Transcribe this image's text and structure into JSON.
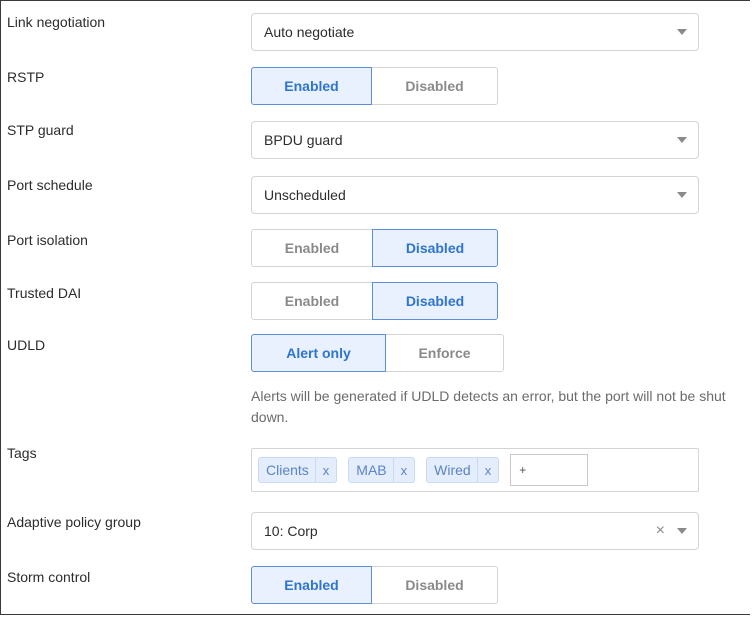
{
  "fields": {
    "link_negotiation": {
      "label": "Link negotiation",
      "value": "Auto negotiate"
    },
    "rstp": {
      "label": "RSTP",
      "options": [
        "Enabled",
        "Disabled"
      ],
      "selected": "Enabled"
    },
    "stp_guard": {
      "label": "STP guard",
      "value": "BPDU guard"
    },
    "port_schedule": {
      "label": "Port schedule",
      "value": "Unscheduled"
    },
    "port_isolation": {
      "label": "Port isolation",
      "options": [
        "Enabled",
        "Disabled"
      ],
      "selected": "Disabled"
    },
    "trusted_dai": {
      "label": "Trusted DAI",
      "options": [
        "Enabled",
        "Disabled"
      ],
      "selected": "Disabled"
    },
    "udld": {
      "label": "UDLD",
      "options": [
        "Alert only",
        "Enforce"
      ],
      "selected": "Alert only",
      "help": "Alerts will be generated if UDLD detects an error, but the port will not be shut down."
    },
    "tags": {
      "label": "Tags",
      "items": [
        "Clients",
        "MAB",
        "Wired"
      ],
      "remove_glyph": "x",
      "input_placeholder": "+"
    },
    "adaptive_policy_group": {
      "label": "Adaptive policy group",
      "value": "10: Corp",
      "clear_glyph": "×"
    },
    "storm_control": {
      "label": "Storm control",
      "options": [
        "Enabled",
        "Disabled"
      ],
      "selected": "Enabled"
    }
  },
  "colors": {
    "accent": "#2f74d0",
    "active_bg": "#e8f1fd",
    "tag_bg": "#e3edfb",
    "tag_text": "#5c84c6"
  }
}
